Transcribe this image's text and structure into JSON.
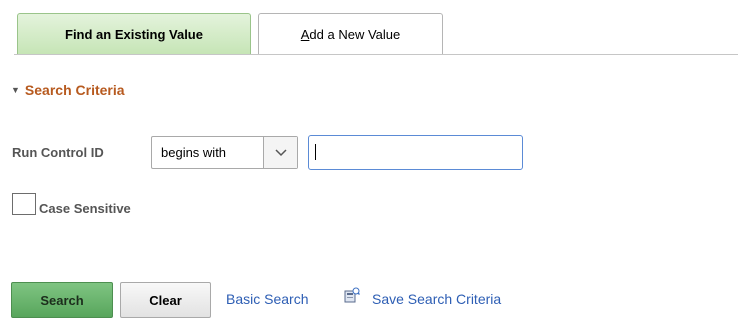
{
  "tabs": {
    "find_existing": "Find an Existing Value",
    "add_new_underlined": "A",
    "add_new_rest": "dd a New Value"
  },
  "section": {
    "title": "Search Criteria",
    "toggle_icon": "triangle-down-icon"
  },
  "criteria": {
    "run_control_label": "Run Control ID",
    "operator_value": "begins with",
    "run_control_value": "",
    "case_sensitive_label": "Case Sensitive",
    "case_sensitive_checked": false
  },
  "actions": {
    "search_label": "Search",
    "clear_label": "Clear",
    "basic_search_label": "Basic Search",
    "save_search_label": "Save Search Criteria",
    "save_icon": "save-search-icon"
  },
  "colors": {
    "active_tab": "#c6e5b6",
    "section_title": "#b75a1f",
    "search_button": "#58a65c",
    "link": "#2d5eb4"
  }
}
